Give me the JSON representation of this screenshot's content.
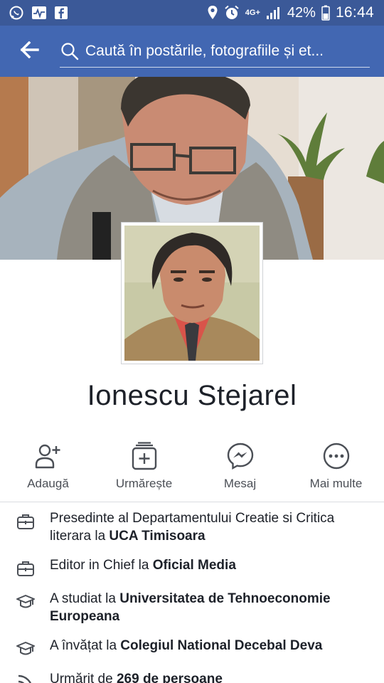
{
  "status_bar": {
    "network": "4G+",
    "battery": "42%",
    "time": "16:44"
  },
  "header": {
    "search_placeholder": "Caută în postările, fotografiile și et..."
  },
  "profile": {
    "name": "Ionescu Stejarel"
  },
  "actions": [
    {
      "label": "Adaugă",
      "icon": "add-friend-icon"
    },
    {
      "label": "Urmărește",
      "icon": "follow-icon"
    },
    {
      "label": "Mesaj",
      "icon": "messenger-icon"
    },
    {
      "label": "Mai multe",
      "icon": "more-icon"
    }
  ],
  "info": [
    {
      "icon": "briefcase-icon",
      "prefix": "Presedinte al Departamentului Creatie si Critica literara la ",
      "bold": "UCA Timisoara"
    },
    {
      "icon": "briefcase-icon",
      "prefix": "Editor in Chief la ",
      "bold": "Oficial Media"
    },
    {
      "icon": "graduation-cap-icon",
      "prefix": "A studiat la ",
      "bold": "Universitatea de Tehnoeconomie Europeana"
    },
    {
      "icon": "graduation-cap-icon",
      "prefix": "A învățat la ",
      "bold": "Colegiul National Decebal Deva"
    },
    {
      "icon": "followers-icon",
      "prefix": "Urmărit de ",
      "bold": "269 de persoane"
    }
  ]
}
